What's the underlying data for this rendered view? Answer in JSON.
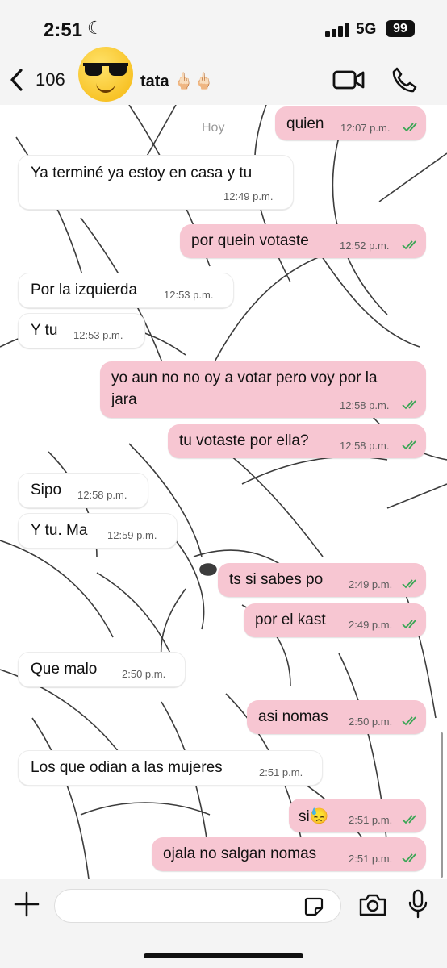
{
  "status_bar": {
    "time": "2:51",
    "network": "5G",
    "battery": "99"
  },
  "header": {
    "back_count": "106",
    "contact_name": "tata 🖕🏻🖕🏻"
  },
  "chat": {
    "day_label": "Hoy",
    "messages": [
      {
        "dir": "out",
        "text": "quien",
        "time": "12:07 p.m.",
        "read": true
      },
      {
        "dir": "in",
        "text": "Ya terminé ya estoy en casa y tu",
        "time": "12:49 p.m."
      },
      {
        "dir": "out",
        "text": "por quein votaste",
        "time": "12:52 p.m.",
        "read": true
      },
      {
        "dir": "in",
        "text": "Por la izquierda",
        "time": "12:53 p.m."
      },
      {
        "dir": "in",
        "text": "Y tu",
        "time": "12:53 p.m."
      },
      {
        "dir": "out",
        "text_line1": "yo aun no no oy a votar pero voy por la",
        "text_line2": "jara",
        "time": "12:58 p.m.",
        "read": true
      },
      {
        "dir": "out",
        "text": "tu votaste por ella?",
        "time": "12:58 p.m.",
        "read": true
      },
      {
        "dir": "in",
        "text": "Sipo",
        "time": "12:58 p.m."
      },
      {
        "dir": "in",
        "text": "Y tu. Ma",
        "time": "12:59 p.m."
      },
      {
        "dir": "out",
        "text": "ts si sabes po",
        "time": "2:49 p.m.",
        "read": true
      },
      {
        "dir": "out",
        "text": "por el kast",
        "time": "2:49 p.m.",
        "read": true
      },
      {
        "dir": "in",
        "text": "Que  malo",
        "time": "2:50 p.m."
      },
      {
        "dir": "out",
        "text": "asi nomas",
        "time": "2:50 p.m.",
        "read": true
      },
      {
        "dir": "in",
        "text": "Los que odian a las mujeres",
        "time": "2:51 p.m."
      },
      {
        "dir": "out",
        "text": "si😓",
        "time": "2:51 p.m.",
        "read": true
      },
      {
        "dir": "out",
        "text": "ojala no salgan nomas",
        "time": "2:51 p.m.",
        "read": true
      }
    ]
  },
  "input_bar": {
    "placeholder": ""
  },
  "colors": {
    "outgoing": "#f7c6d2",
    "incoming": "#ffffff",
    "read_ticks": "#3aa655"
  },
  "icons": [
    "moon-icon",
    "signal-icon",
    "back-chevron-icon",
    "video-icon",
    "phone-icon",
    "plus-icon",
    "sticker-icon",
    "camera-icon",
    "mic-icon"
  ]
}
